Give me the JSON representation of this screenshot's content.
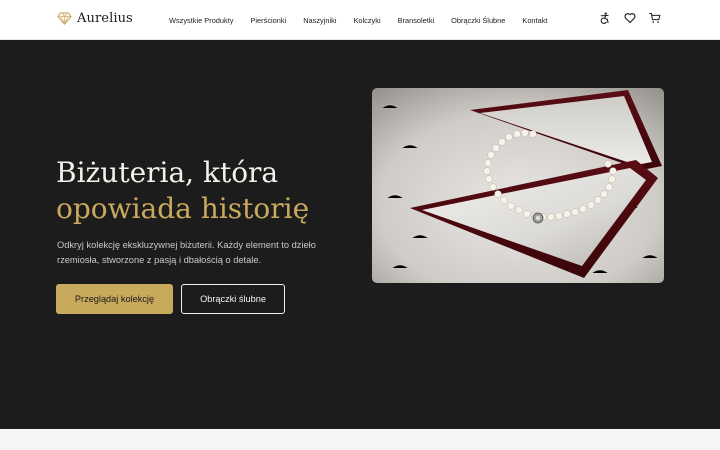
{
  "brand": {
    "name": "Aurelius",
    "icon": "diamond-icon",
    "accent": "#c9a95c"
  },
  "nav": {
    "items": [
      {
        "label": "Wszystkie Produkty"
      },
      {
        "label": "Pierścionki"
      },
      {
        "label": "Naszyjniki"
      },
      {
        "label": "Kolczyki"
      },
      {
        "label": "Bransoletki"
      },
      {
        "label": "Obrączki Ślubne"
      },
      {
        "label": "Kontakt"
      }
    ]
  },
  "header_icons": [
    "accessibility-icon",
    "heart-icon",
    "cart-icon"
  ],
  "hero": {
    "title_line1": "Biżuteria, która",
    "title_line2": "opowiada historię",
    "description": "Odkryj kolekcję ekskluzywnej biżuterii. Każdy element to dzieło rzemiosła, stworzone z pasją i dbałością o detale.",
    "primary_button": "Przeglądaj kolekcję",
    "secondary_button": "Obrączki ślubne",
    "background": "#1c1c1c",
    "title_color": "#f4f1ea"
  }
}
